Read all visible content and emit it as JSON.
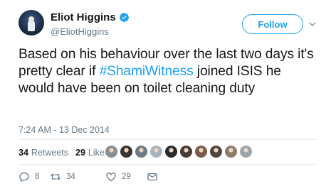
{
  "user": {
    "name": "Eliot Higgins",
    "handle": "@EliotHiggins",
    "verified": true
  },
  "follow_label": "Follow",
  "tweet": {
    "text_before": "Based on his behaviour over the last two days it's pretty clear if ",
    "hashtag": "#ShamiWitness",
    "text_after": " joined ISIS he would have been on toilet cleaning duty"
  },
  "timestamp": "7:24 AM - 13 Dec 2014",
  "stats": {
    "retweets_count": "34",
    "retweets_label": "Retweets",
    "likes_count": "29",
    "likes_label": "Likes"
  },
  "liker_avatar_colors": [
    "#8a8d91",
    "#3a3330",
    "#6d7a86",
    "#a7b4c0",
    "#2b2b2b",
    "#4a3b35",
    "#7b5a49",
    "#50463f",
    "#8e7b6a",
    "#9aa5ad"
  ],
  "actions": {
    "reply_count": "8",
    "retweet_count": "34",
    "like_count": "29"
  },
  "colors": {
    "accent": "#1da1f2",
    "text": "#14171a",
    "muted": "#657786"
  }
}
